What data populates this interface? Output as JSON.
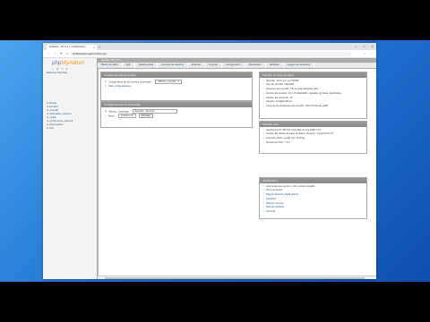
{
  "browser": {
    "tab_title": "localhost / 127.0.0.1 | phpMyAdmin",
    "tab_close": "×",
    "new_tab": "+",
    "address": "localhost/phpmyadmin/index.php",
    "window_buttons": [
      "–",
      "□",
      "×"
    ],
    "nav_icons": [
      "←",
      "→",
      "⟳",
      "⌂"
    ],
    "toolbar_icons": [
      "☆",
      "⋮"
    ]
  },
  "sidebar": {
    "logo_php": "php",
    "logo_my": "MyAdmin",
    "quick_icons": [
      "⌂",
      "⚙",
      "?",
      "⟳"
    ],
    "tabs": "Recientes   Favoritas",
    "databases": [
      {
        "name": "Nueva",
        "pm": "⊕"
      },
      {
        "name": "bernard",
        "pm": "⊕"
      },
      {
        "name": "cursodb",
        "pm": "⊕"
      },
      {
        "name": "information_schema",
        "pm": "⊕"
      },
      {
        "name": "mysql",
        "pm": "⊕"
      },
      {
        "name": "performance_schema",
        "pm": "⊕"
      },
      {
        "name": "phpmyadmin",
        "pm": "⊕"
      },
      {
        "name": "test",
        "pm": "⊕"
      }
    ]
  },
  "topbar": {
    "crumb": "Servidor: 127.0.0.1"
  },
  "menu": [
    "Bases de datos",
    "SQL",
    "Estado actual",
    "Cuentas de usuarios",
    "Exportar",
    "Importar",
    "Configuración",
    "Replicación",
    "Variables",
    "Juegos de caracteres"
  ],
  "general_settings": {
    "title": "Configuraciones generales",
    "collation_label": "Cotejamiento de la conexión al servidor:",
    "collation_value": "utf8mb4_unicode_ci",
    "more_settings": "Más configuraciones"
  },
  "appearance": {
    "title": "Configuraciones de apariencia",
    "language_label": "Idioma - Language",
    "language_value": "Español - Spanish",
    "theme_label": "Tema:",
    "theme_value": "pmahomme",
    "view_all": "Ver todo"
  },
  "db_server": {
    "title": "Servidor de base de datos",
    "items": [
      "Servidor: 127.0.0.1 via TCP/IP",
      "Tipo de servidor: MariaDB",
      "Conexión del servidor: No se está utilizando SSL",
      "Versión del servidor: 10.1.37-MariaDB - mariadb.org binary distribution",
      "Versión del protocolo: 10",
      "Usuario: root@localhost",
      "Conjunto de caracteres del servidor: UTF-8 Unicode (utf8)"
    ]
  },
  "web_server": {
    "title": "Servidor web",
    "items": [
      "Apache/2.4.37 (Win32) OpenSSL/1.1.1a PHP/7.3.0",
      "Versión del cliente de base de datos: libmysql - mysqlnd 5.0.12",
      "extensión PHP: mysqli curl mbstring",
      "Versión de PHP: 7.3.0"
    ]
  },
  "phpmyadmin": {
    "title": "phpMyAdmin",
    "items": [
      "Acerca de esta versión: 4.8.4, versión estable",
      "Documentación",
      "Página oficial de phpMyAdmin",
      "Contribuir",
      "Obtener soporte",
      "Lista de cambios",
      "Licencia"
    ]
  }
}
